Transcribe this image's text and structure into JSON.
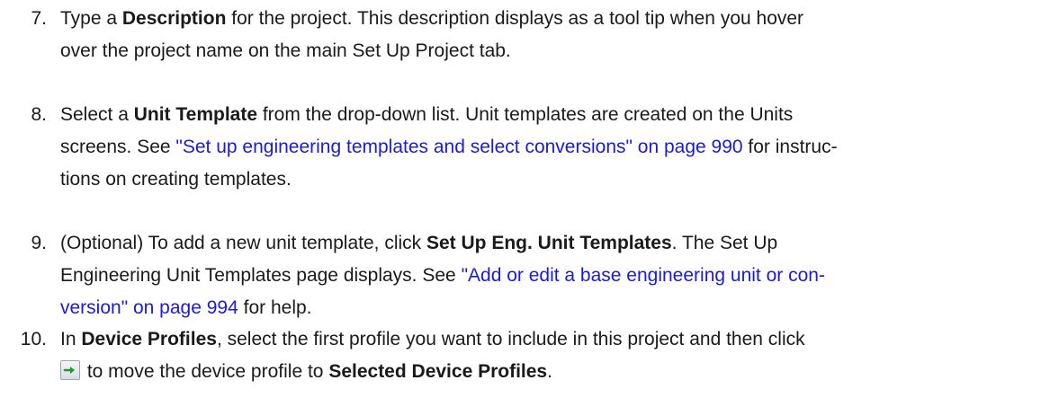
{
  "steps": [
    {
      "number": "7.",
      "lines": [
        {
          "t1": "Type a ",
          "b1": "Description",
          "t2": " for the project. This description displays as a tool tip when you hover"
        },
        {
          "t1": "over the project name on the main Set Up Project tab."
        }
      ]
    },
    {
      "number": "8.",
      "lines": [
        {
          "t1": "Select a ",
          "b1": "Unit Template",
          "t2": " from the drop-down list. Unit templates are created on the Units"
        },
        {
          "t1": "screens. See ",
          "link": "\"Set up engineering templates and select conversions\" on page 990",
          "t2": " for instruc-"
        },
        {
          "t1": "tions on creating templates."
        }
      ]
    },
    {
      "number": "9.",
      "lines": [
        {
          "t1": "(Optional) To add a new unit template, click ",
          "b1": "Set Up Eng. Unit Templates",
          "t2": ". The Set Up"
        },
        {
          "t1": "Engineering Unit Templates page displays. See ",
          "link": "\"Add or edit a base engineering unit or con-"
        },
        {
          "link": "version\" on page 994",
          "t2": " for help."
        }
      ]
    },
    {
      "number": "10.",
      "lines": [
        {
          "t1": "In ",
          "b1": "Device Profiles",
          "t2": ", select the first profile you want to include in this project and then click"
        },
        {
          "icon": "move-right-arrow-icon",
          "t1": " to move the device profile to ",
          "b1": "Selected Device Profiles",
          "t2": "."
        }
      ]
    }
  ]
}
